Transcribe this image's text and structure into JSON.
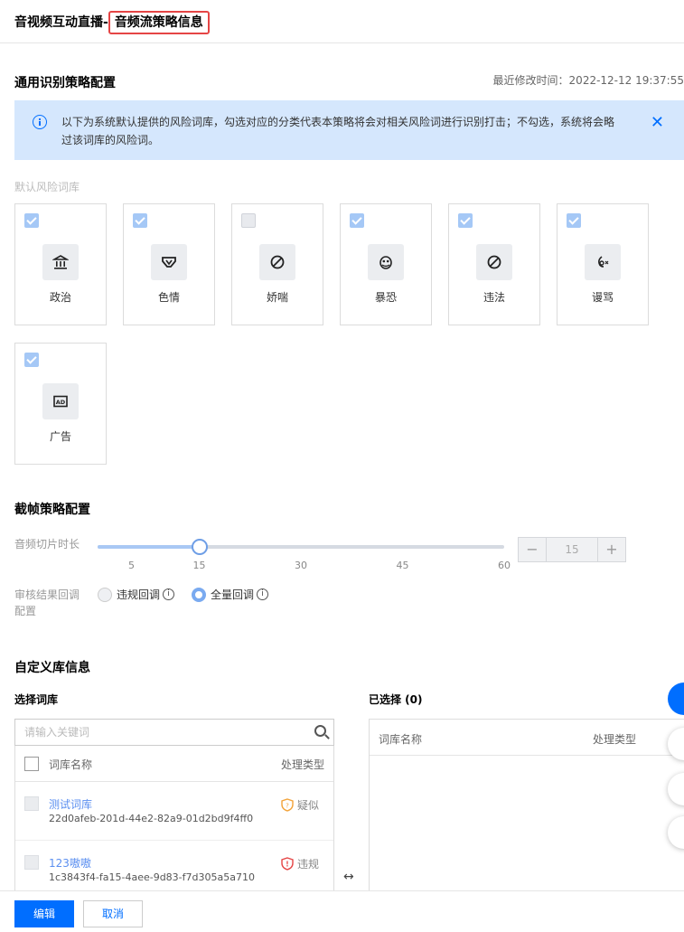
{
  "header": {
    "title_main": "音视频互动直播-",
    "title_highlight": "音频流策略信息"
  },
  "general": {
    "title": "通用识别策略配置",
    "modified": "最近修改时间：2022-12-12 19:37:55",
    "notice": "以下为系统默认提供的风险词库，勾选对应的分类代表本策略将会对相关风险词进行识别打击；不勾选，系统将会略过该词库的风险词。",
    "lib_label": "默认风险词库",
    "libraries": [
      {
        "label": "政治",
        "checked": true,
        "icon": "government-building-icon"
      },
      {
        "label": "色情",
        "checked": true,
        "icon": "underwear-icon"
      },
      {
        "label": "娇喘",
        "checked": false,
        "icon": "prohibited-icon"
      },
      {
        "label": "暴恐",
        "checked": true,
        "icon": "masked-face-icon"
      },
      {
        "label": "违法",
        "checked": true,
        "icon": "prohibited-icon"
      },
      {
        "label": "谩骂",
        "checked": true,
        "icon": "abuse-speech-icon"
      },
      {
        "label": "广告",
        "checked": true,
        "icon": "ad-icon"
      }
    ]
  },
  "frame": {
    "title": "截帧策略配置",
    "slice_label": "音频切片时长",
    "slider": {
      "min": 0,
      "max": 60,
      "value": 15,
      "ticks": [
        "5",
        "15",
        "30",
        "45",
        "60"
      ]
    },
    "stepper": {
      "minus": "−",
      "value": "15",
      "plus": "+"
    },
    "callback_label": "审核结果回调配置",
    "callback_options": [
      {
        "label": "违规回调",
        "selected": false
      },
      {
        "label": "全量回调",
        "selected": true
      }
    ],
    "help_glyph": "i"
  },
  "custom": {
    "title": "自定义库信息",
    "select_title": "选择词库",
    "selected_title": "已选择 (0)",
    "search_placeholder": "请输入关键词",
    "columns": {
      "name": "词库名称",
      "type": "处理类型"
    },
    "rows": [
      {
        "name": "测试词库",
        "id": "22d0afeb-201d-44e2-82a9-01d2bd9f4ff0",
        "type": "疑似",
        "type_color": "#f2a33a"
      },
      {
        "name": "123嗷嗷",
        "id": "1c3843f4-fa15-4aee-9d83-f7d305a5a710",
        "type": "违规",
        "type_color": "#e54545"
      }
    ],
    "swap_glyph": "↔"
  },
  "footer": {
    "edit": "编辑",
    "cancel": "取消"
  },
  "colors": {
    "primary": "#006eff",
    "notice_bg": "#d5e7fd",
    "highlight_border": "#e54545"
  }
}
